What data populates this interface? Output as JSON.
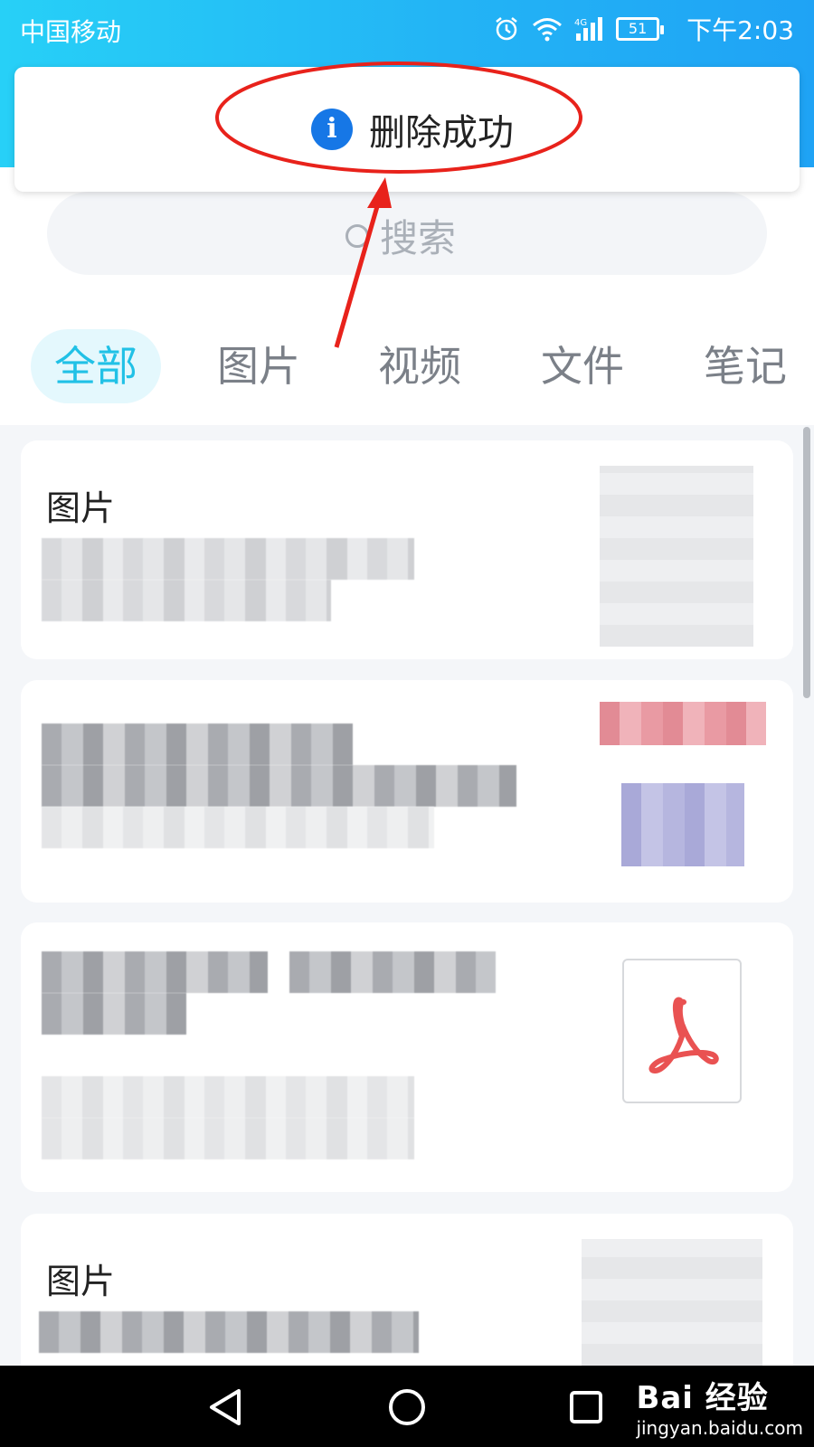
{
  "status_bar": {
    "carrier": "中国移动",
    "network": "4G",
    "battery": "51",
    "time": "下午2:03"
  },
  "toast": {
    "icon": "info-icon",
    "icon_glyph": "i",
    "message": "删除成功"
  },
  "search": {
    "placeholder": "搜索"
  },
  "tabs": [
    {
      "label": "全部",
      "active": true
    },
    {
      "label": "图片"
    },
    {
      "label": "视频"
    },
    {
      "label": "文件"
    },
    {
      "label": "笔记"
    }
  ],
  "cards": [
    {
      "title": "图片"
    },
    {
      "title": ""
    },
    {
      "title": "",
      "thumbnail": "pdf-icon"
    },
    {
      "title": "图片"
    }
  ],
  "watermark": {
    "logo": "Bai 经验",
    "url": "jingyan.baidu.com"
  },
  "colors": {
    "header_gradient_start": "#27d0f7",
    "header_gradient_end": "#1fa3f5",
    "active_tab": "#21c1e6",
    "info_blue": "#1677e6",
    "annotation_red": "#e8221b",
    "pdf_red": "#e95252"
  }
}
